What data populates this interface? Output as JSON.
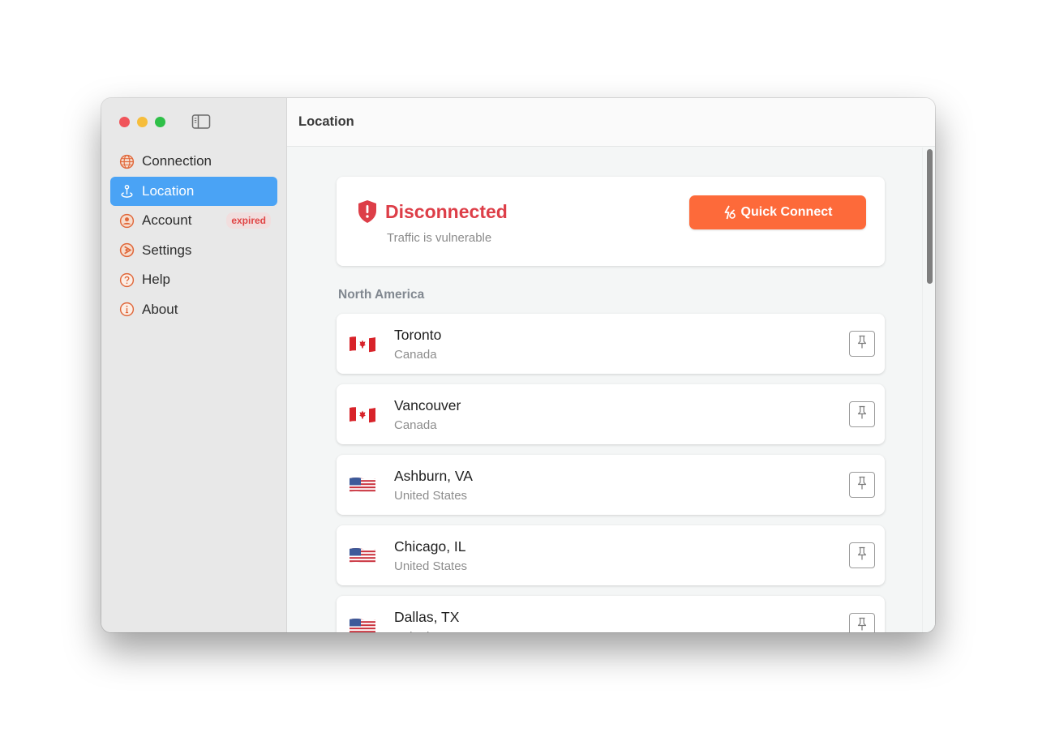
{
  "window": {
    "title": "Location"
  },
  "sidebar": {
    "items": [
      {
        "label": "Connection",
        "icon": "globe-icon",
        "active": false
      },
      {
        "label": "Location",
        "icon": "location-pin-icon",
        "active": true
      },
      {
        "label": "Account",
        "icon": "person-circle-icon",
        "active": false,
        "badge": "expired"
      },
      {
        "label": "Settings",
        "icon": "settings-icon",
        "active": false
      },
      {
        "label": "Help",
        "icon": "question-circle-icon",
        "active": false
      },
      {
        "label": "About",
        "icon": "info-circle-icon",
        "active": false
      }
    ]
  },
  "status": {
    "title": "Disconnected",
    "subtitle": "Traffic is vulnerable",
    "quick_connect_label": "Quick Connect"
  },
  "region": {
    "title": "North America",
    "locations": [
      {
        "city": "Toronto",
        "country": "Canada",
        "flag": "canada"
      },
      {
        "city": "Vancouver",
        "country": "Canada",
        "flag": "canada"
      },
      {
        "city": "Ashburn, VA",
        "country": "United States",
        "flag": "usa"
      },
      {
        "city": "Chicago, IL",
        "country": "United States",
        "flag": "usa"
      },
      {
        "city": "Dallas, TX",
        "country": "United States",
        "flag": "usa"
      }
    ]
  },
  "colors": {
    "accent": "#4aa3f5",
    "danger": "#dd3e48",
    "quick_connect": "#fd6a3a",
    "icon_orange": "#e0673a"
  }
}
